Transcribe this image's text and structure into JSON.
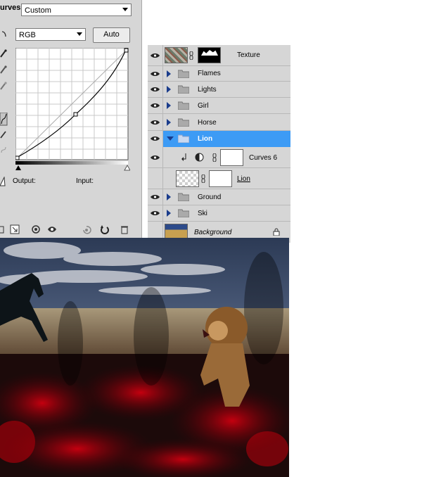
{
  "curves_panel": {
    "title": "urves",
    "preset": "Custom",
    "channel": "RGB",
    "auto_label": "Auto",
    "output_label": "Output:",
    "input_label": "Input:"
  },
  "layers": {
    "rows": [
      {
        "name": "Texture"
      },
      {
        "name": "Flames"
      },
      {
        "name": "Lights"
      },
      {
        "name": "Girl"
      },
      {
        "name": "Horse"
      },
      {
        "name": "Lion"
      },
      {
        "name": "Curves 6"
      },
      {
        "name": "Lion"
      },
      {
        "name": "Ground"
      },
      {
        "name": "Ski"
      },
      {
        "name": "Background"
      }
    ]
  },
  "colors": {
    "panel_bg": "#d6d6d6",
    "selection": "#3d9bf5",
    "expander": "#1a3c8c"
  }
}
